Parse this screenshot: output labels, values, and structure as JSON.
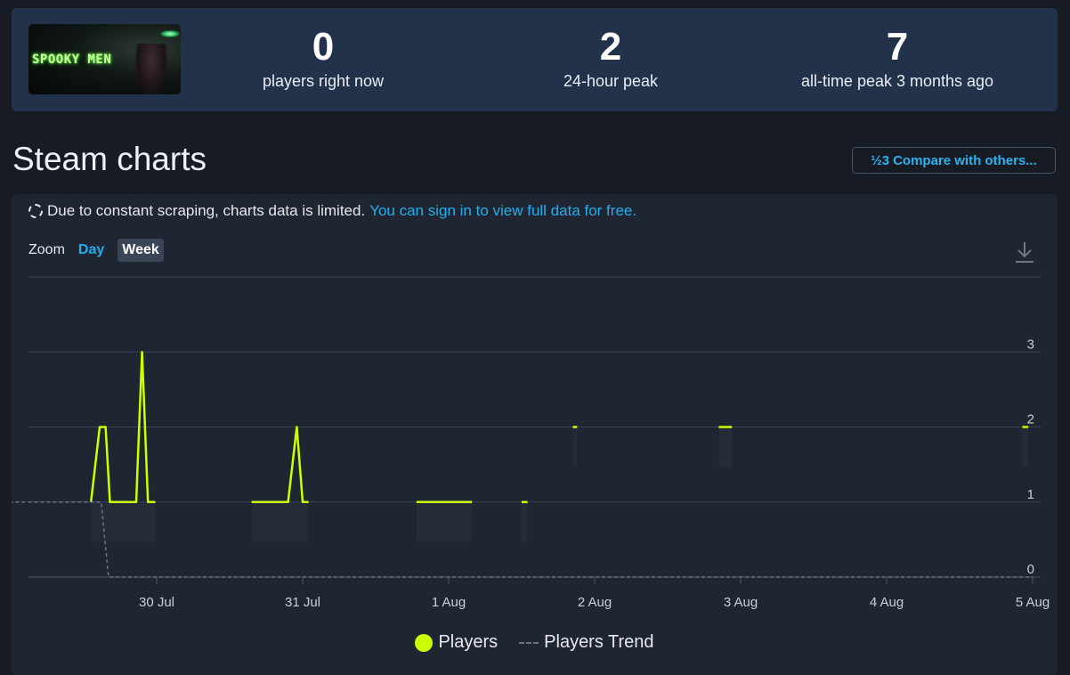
{
  "game": {
    "thumbnail_text": "SPOOKY MEN"
  },
  "stats": [
    {
      "value": "0",
      "label": "players right now"
    },
    {
      "value": "2",
      "label": "24-hour peak"
    },
    {
      "value": "7",
      "label": "all-time peak 3 months ago"
    }
  ],
  "page_title": "Steam charts",
  "compare_button": {
    "icon": "½3",
    "label": "Compare with others..."
  },
  "notice": {
    "text": "Due to constant scraping, charts data is limited.",
    "link": "You can sign in to view full data for free."
  },
  "zoom": {
    "label": "Zoom",
    "day": "Day",
    "week": "Week"
  },
  "legend": {
    "players": "Players",
    "trend": "Players Trend"
  },
  "colors": {
    "players": "#ccff00",
    "trend": "#6b7482",
    "link": "#22aef0"
  },
  "chart_data": {
    "type": "line",
    "x_tick_labels": [
      "30 Jul",
      "31 Jul",
      "1 Aug",
      "2 Aug",
      "3 Aug",
      "4 Aug",
      "5 Aug"
    ],
    "y_ticks": [
      0,
      1,
      2,
      3
    ],
    "ylim": [
      0,
      4
    ],
    "grid": true,
    "legend_position": "bottom",
    "series": [
      {
        "name": "Players",
        "segments": [
          [
            [
              29.55,
              1
            ],
            [
              29.61,
              2
            ],
            [
              29.65,
              2
            ],
            [
              29.68,
              1
            ],
            [
              29.86,
              1
            ],
            [
              29.9,
              3
            ],
            [
              29.94,
              1
            ],
            [
              29.99,
              1
            ]
          ],
          [
            [
              30.65,
              1
            ],
            [
              30.9,
              1
            ],
            [
              30.96,
              2
            ],
            [
              31.0,
              1
            ],
            [
              31.04,
              1
            ]
          ],
          [
            [
              31.78,
              1
            ],
            [
              32.16,
              1
            ]
          ],
          [
            [
              32.5,
              1
            ],
            [
              32.54,
              1
            ]
          ],
          [
            [
              32.85,
              2
            ],
            [
              32.88,
              2
            ]
          ],
          [
            [
              33.85,
              2
            ],
            [
              33.94,
              2
            ]
          ],
          [
            [
              35.93,
              2
            ],
            [
              35.97,
              2
            ]
          ]
        ]
      },
      {
        "name": "Players Trend",
        "values": [
          [
            28.99,
            1
          ],
          [
            29.62,
            1
          ],
          [
            29.67,
            0
          ],
          [
            36.0,
            0
          ]
        ]
      }
    ]
  }
}
